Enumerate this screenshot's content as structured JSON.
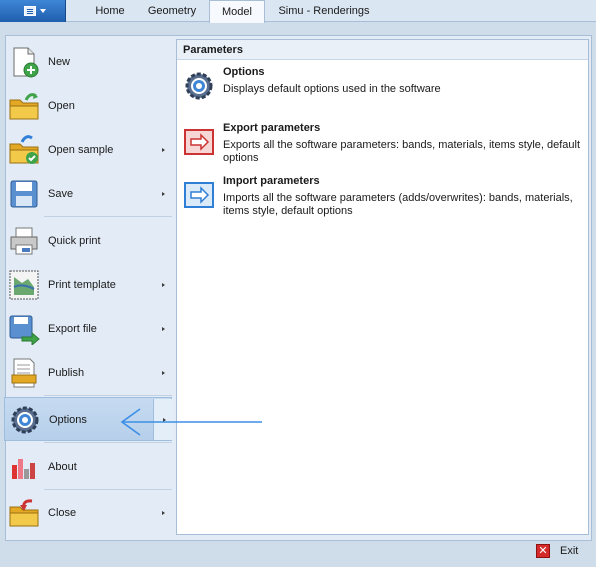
{
  "ribbon": {
    "app_button_icon": "menu-icon",
    "tabs": [
      {
        "label": "Home"
      },
      {
        "label": "Geometry"
      },
      {
        "label": "Model"
      },
      {
        "label": "Simu - Renderings"
      }
    ],
    "active_tab": "Model"
  },
  "menu": {
    "items": [
      {
        "label": "New",
        "icon": "new-document-icon"
      },
      {
        "label": "Open",
        "icon": "open-folder-icon"
      },
      {
        "label": "Open sample",
        "icon": "open-sample-icon"
      },
      {
        "label": "Save",
        "icon": "save-icon"
      },
      {
        "label": "Quick print",
        "icon": "printer-icon"
      },
      {
        "label": "Print template",
        "icon": "print-template-icon"
      },
      {
        "label": "Export file",
        "icon": "export-file-icon"
      },
      {
        "label": "Publish",
        "icon": "publish-icon"
      },
      {
        "label": "Options",
        "icon": "gear-icon"
      },
      {
        "label": "About",
        "icon": "about-icon"
      },
      {
        "label": "Close",
        "icon": "close-folder-icon"
      }
    ],
    "selected": "Options"
  },
  "panel": {
    "title": "Parameters",
    "entries": [
      {
        "title": "Options",
        "description": "Displays default options used in the software",
        "icon": "gear-icon"
      },
      {
        "title": "Export parameters",
        "description": "Exports all the software parameters: bands, materials, items style, default options",
        "icon": "export-icon"
      },
      {
        "title": "Import parameters",
        "description": "Imports all the software parameters (adds/overwrites): bands, materials, items style, default options",
        "icon": "import-icon"
      }
    ]
  },
  "footer": {
    "exit_label": "Exit",
    "exit_icon": "exit-icon"
  },
  "colors": {
    "accent": "#1f5fae",
    "backstage_bg": "#e3ecf6",
    "selected_bg": "#b6cfea",
    "annotation_arrow": "#3d8fe6"
  }
}
